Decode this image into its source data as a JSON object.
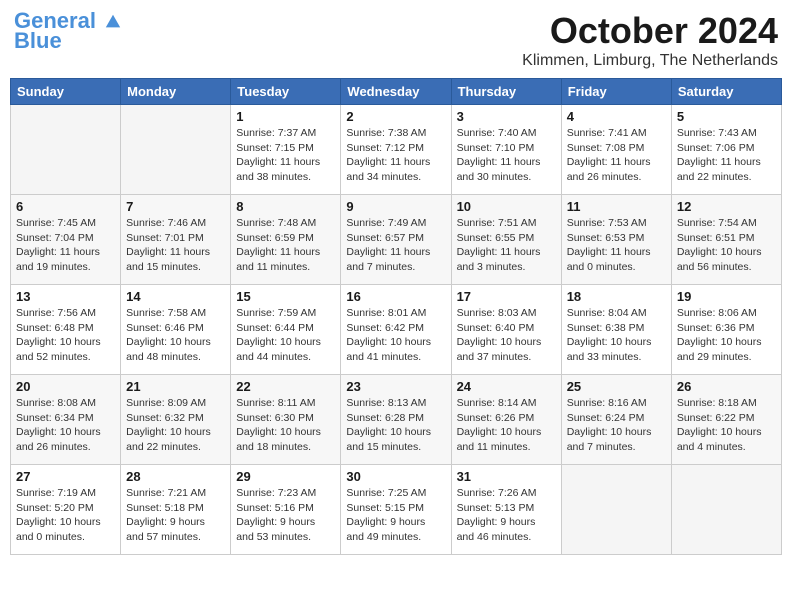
{
  "header": {
    "logo_line1": "General",
    "logo_line2": "Blue",
    "month": "October 2024",
    "location": "Klimmen, Limburg, The Netherlands"
  },
  "days_of_week": [
    "Sunday",
    "Monday",
    "Tuesday",
    "Wednesday",
    "Thursday",
    "Friday",
    "Saturday"
  ],
  "weeks": [
    [
      {
        "day": "",
        "info": "",
        "empty": true
      },
      {
        "day": "",
        "info": "",
        "empty": true
      },
      {
        "day": "1",
        "info": "Sunrise: 7:37 AM\nSunset: 7:15 PM\nDaylight: 11 hours\nand 38 minutes.",
        "empty": false
      },
      {
        "day": "2",
        "info": "Sunrise: 7:38 AM\nSunset: 7:12 PM\nDaylight: 11 hours\nand 34 minutes.",
        "empty": false
      },
      {
        "day": "3",
        "info": "Sunrise: 7:40 AM\nSunset: 7:10 PM\nDaylight: 11 hours\nand 30 minutes.",
        "empty": false
      },
      {
        "day": "4",
        "info": "Sunrise: 7:41 AM\nSunset: 7:08 PM\nDaylight: 11 hours\nand 26 minutes.",
        "empty": false
      },
      {
        "day": "5",
        "info": "Sunrise: 7:43 AM\nSunset: 7:06 PM\nDaylight: 11 hours\nand 22 minutes.",
        "empty": false
      }
    ],
    [
      {
        "day": "6",
        "info": "Sunrise: 7:45 AM\nSunset: 7:04 PM\nDaylight: 11 hours\nand 19 minutes.",
        "empty": false
      },
      {
        "day": "7",
        "info": "Sunrise: 7:46 AM\nSunset: 7:01 PM\nDaylight: 11 hours\nand 15 minutes.",
        "empty": false
      },
      {
        "day": "8",
        "info": "Sunrise: 7:48 AM\nSunset: 6:59 PM\nDaylight: 11 hours\nand 11 minutes.",
        "empty": false
      },
      {
        "day": "9",
        "info": "Sunrise: 7:49 AM\nSunset: 6:57 PM\nDaylight: 11 hours\nand 7 minutes.",
        "empty": false
      },
      {
        "day": "10",
        "info": "Sunrise: 7:51 AM\nSunset: 6:55 PM\nDaylight: 11 hours\nand 3 minutes.",
        "empty": false
      },
      {
        "day": "11",
        "info": "Sunrise: 7:53 AM\nSunset: 6:53 PM\nDaylight: 11 hours\nand 0 minutes.",
        "empty": false
      },
      {
        "day": "12",
        "info": "Sunrise: 7:54 AM\nSunset: 6:51 PM\nDaylight: 10 hours\nand 56 minutes.",
        "empty": false
      }
    ],
    [
      {
        "day": "13",
        "info": "Sunrise: 7:56 AM\nSunset: 6:48 PM\nDaylight: 10 hours\nand 52 minutes.",
        "empty": false
      },
      {
        "day": "14",
        "info": "Sunrise: 7:58 AM\nSunset: 6:46 PM\nDaylight: 10 hours\nand 48 minutes.",
        "empty": false
      },
      {
        "day": "15",
        "info": "Sunrise: 7:59 AM\nSunset: 6:44 PM\nDaylight: 10 hours\nand 44 minutes.",
        "empty": false
      },
      {
        "day": "16",
        "info": "Sunrise: 8:01 AM\nSunset: 6:42 PM\nDaylight: 10 hours\nand 41 minutes.",
        "empty": false
      },
      {
        "day": "17",
        "info": "Sunrise: 8:03 AM\nSunset: 6:40 PM\nDaylight: 10 hours\nand 37 minutes.",
        "empty": false
      },
      {
        "day": "18",
        "info": "Sunrise: 8:04 AM\nSunset: 6:38 PM\nDaylight: 10 hours\nand 33 minutes.",
        "empty": false
      },
      {
        "day": "19",
        "info": "Sunrise: 8:06 AM\nSunset: 6:36 PM\nDaylight: 10 hours\nand 29 minutes.",
        "empty": false
      }
    ],
    [
      {
        "day": "20",
        "info": "Sunrise: 8:08 AM\nSunset: 6:34 PM\nDaylight: 10 hours\nand 26 minutes.",
        "empty": false
      },
      {
        "day": "21",
        "info": "Sunrise: 8:09 AM\nSunset: 6:32 PM\nDaylight: 10 hours\nand 22 minutes.",
        "empty": false
      },
      {
        "day": "22",
        "info": "Sunrise: 8:11 AM\nSunset: 6:30 PM\nDaylight: 10 hours\nand 18 minutes.",
        "empty": false
      },
      {
        "day": "23",
        "info": "Sunrise: 8:13 AM\nSunset: 6:28 PM\nDaylight: 10 hours\nand 15 minutes.",
        "empty": false
      },
      {
        "day": "24",
        "info": "Sunrise: 8:14 AM\nSunset: 6:26 PM\nDaylight: 10 hours\nand 11 minutes.",
        "empty": false
      },
      {
        "day": "25",
        "info": "Sunrise: 8:16 AM\nSunset: 6:24 PM\nDaylight: 10 hours\nand 7 minutes.",
        "empty": false
      },
      {
        "day": "26",
        "info": "Sunrise: 8:18 AM\nSunset: 6:22 PM\nDaylight: 10 hours\nand 4 minutes.",
        "empty": false
      }
    ],
    [
      {
        "day": "27",
        "info": "Sunrise: 7:19 AM\nSunset: 5:20 PM\nDaylight: 10 hours\nand 0 minutes.",
        "empty": false
      },
      {
        "day": "28",
        "info": "Sunrise: 7:21 AM\nSunset: 5:18 PM\nDaylight: 9 hours\nand 57 minutes.",
        "empty": false
      },
      {
        "day": "29",
        "info": "Sunrise: 7:23 AM\nSunset: 5:16 PM\nDaylight: 9 hours\nand 53 minutes.",
        "empty": false
      },
      {
        "day": "30",
        "info": "Sunrise: 7:25 AM\nSunset: 5:15 PM\nDaylight: 9 hours\nand 49 minutes.",
        "empty": false
      },
      {
        "day": "31",
        "info": "Sunrise: 7:26 AM\nSunset: 5:13 PM\nDaylight: 9 hours\nand 46 minutes.",
        "empty": false
      },
      {
        "day": "",
        "info": "",
        "empty": true
      },
      {
        "day": "",
        "info": "",
        "empty": true
      }
    ]
  ]
}
